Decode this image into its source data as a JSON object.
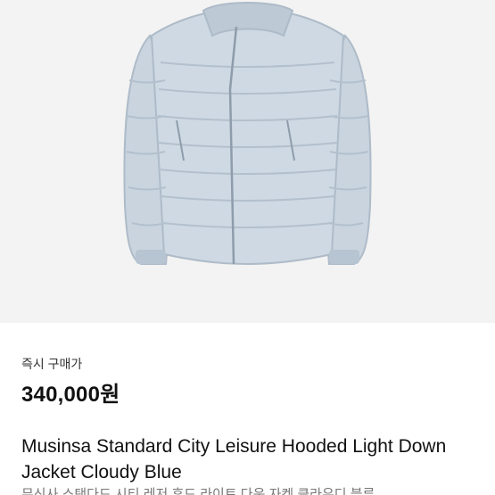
{
  "product": {
    "image_alt": "Light blue hooded down jacket",
    "price_label": "즉시 구매가",
    "price": "340,000원",
    "title": "Musinsa Standard City Leisure Hooded Light Down Jacket Cloudy Blue",
    "subtitle_ko": "무신사 스탠다드 시티 레저 후드 라이트 다운 자켓 클라우디 블루"
  },
  "colors": {
    "jacket": "#c9d4df",
    "jacket_shadow": "#aebbc8",
    "background": "#f3f3f3"
  }
}
